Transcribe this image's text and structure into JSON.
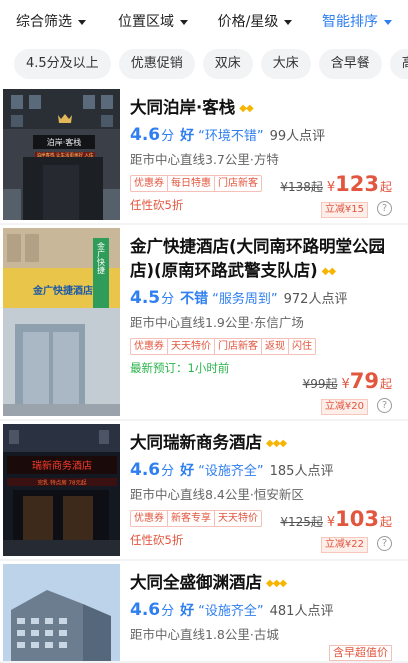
{
  "sort_bar": [
    {
      "label": "综合筛选",
      "active": false
    },
    {
      "label": "位置区域",
      "active": false
    },
    {
      "label": "价格/星级",
      "active": false
    },
    {
      "label": "智能排序",
      "active": true
    }
  ],
  "chips": [
    "4.5分及以上",
    "优惠促销",
    "双床",
    "大床",
    "含早餐",
    "高"
  ],
  "hotels": [
    {
      "name": "大同泊岸·客栈",
      "stars": "◆◆",
      "score": "4.6",
      "fen": "分",
      "label": "好",
      "quote": "“环境不错”",
      "reviews": "99人点评",
      "distance": "距市中心直线3.7公里·方特",
      "tags": [
        "优惠券",
        "每日特惠",
        "门店新客"
      ],
      "promo_text": "任性砍5折",
      "original_price": "¥138起",
      "currency": "¥",
      "price": "123",
      "price_suffix": "起",
      "discount": "立减¥15",
      "help": "?"
    },
    {
      "name": "金广快捷酒店(大同南环路明堂公园店)(原南环路武警支队店)",
      "stars": "◆◆",
      "score": "4.5",
      "fen": "分",
      "label": "不错",
      "quote": "“服务周到”",
      "reviews": "972人点评",
      "distance": "距市中心直线1.9公里·东信广场",
      "tags": [
        "优惠券",
        "天天特价",
        "门店新客",
        "返现",
        "闪住"
      ],
      "promo_text": "最新预订：1小时前",
      "original_price": "¥99起",
      "currency": "¥",
      "price": "79",
      "price_suffix": "起",
      "discount": "立减¥20",
      "help": "?"
    },
    {
      "name": "大同瑞新商务酒店",
      "stars": "◆◆◆",
      "score": "4.6",
      "fen": "分",
      "label": "好",
      "quote": "“设施齐全”",
      "reviews": "185人点评",
      "distance": "距市中心直线8.4公里·恒安新区",
      "tags": [
        "优惠券",
        "新客专享",
        "天天特价"
      ],
      "promo_text": "任性砍5折",
      "original_price": "¥125起",
      "currency": "¥",
      "price": "103",
      "price_suffix": "起",
      "discount": "立减¥22",
      "help": "?"
    },
    {
      "name": "大同全盛御渊酒店",
      "stars": "◆◆◆",
      "score": "4.6",
      "fen": "分",
      "label": "好",
      "quote": "“设施齐全”",
      "reviews": "481人点评",
      "distance": "距市中心直线1.8公里·古城",
      "tags_partial": "含早超值价"
    }
  ],
  "thumb_texts": {
    "h1_sign": "泊岸·客栈",
    "h1_banner": "泊岸客栈 让生活更美好 入住",
    "h2_sign": "金广快捷酒店",
    "h2_vertical": "金广快捷",
    "h3_sign": "瑞新商务酒店",
    "h3_banner": "完乳 特点房 78元起"
  },
  "colors": {
    "accent": "#2f7ff0",
    "price": "#e2553e",
    "green": "#2bb34b",
    "star": "#f7b500"
  }
}
